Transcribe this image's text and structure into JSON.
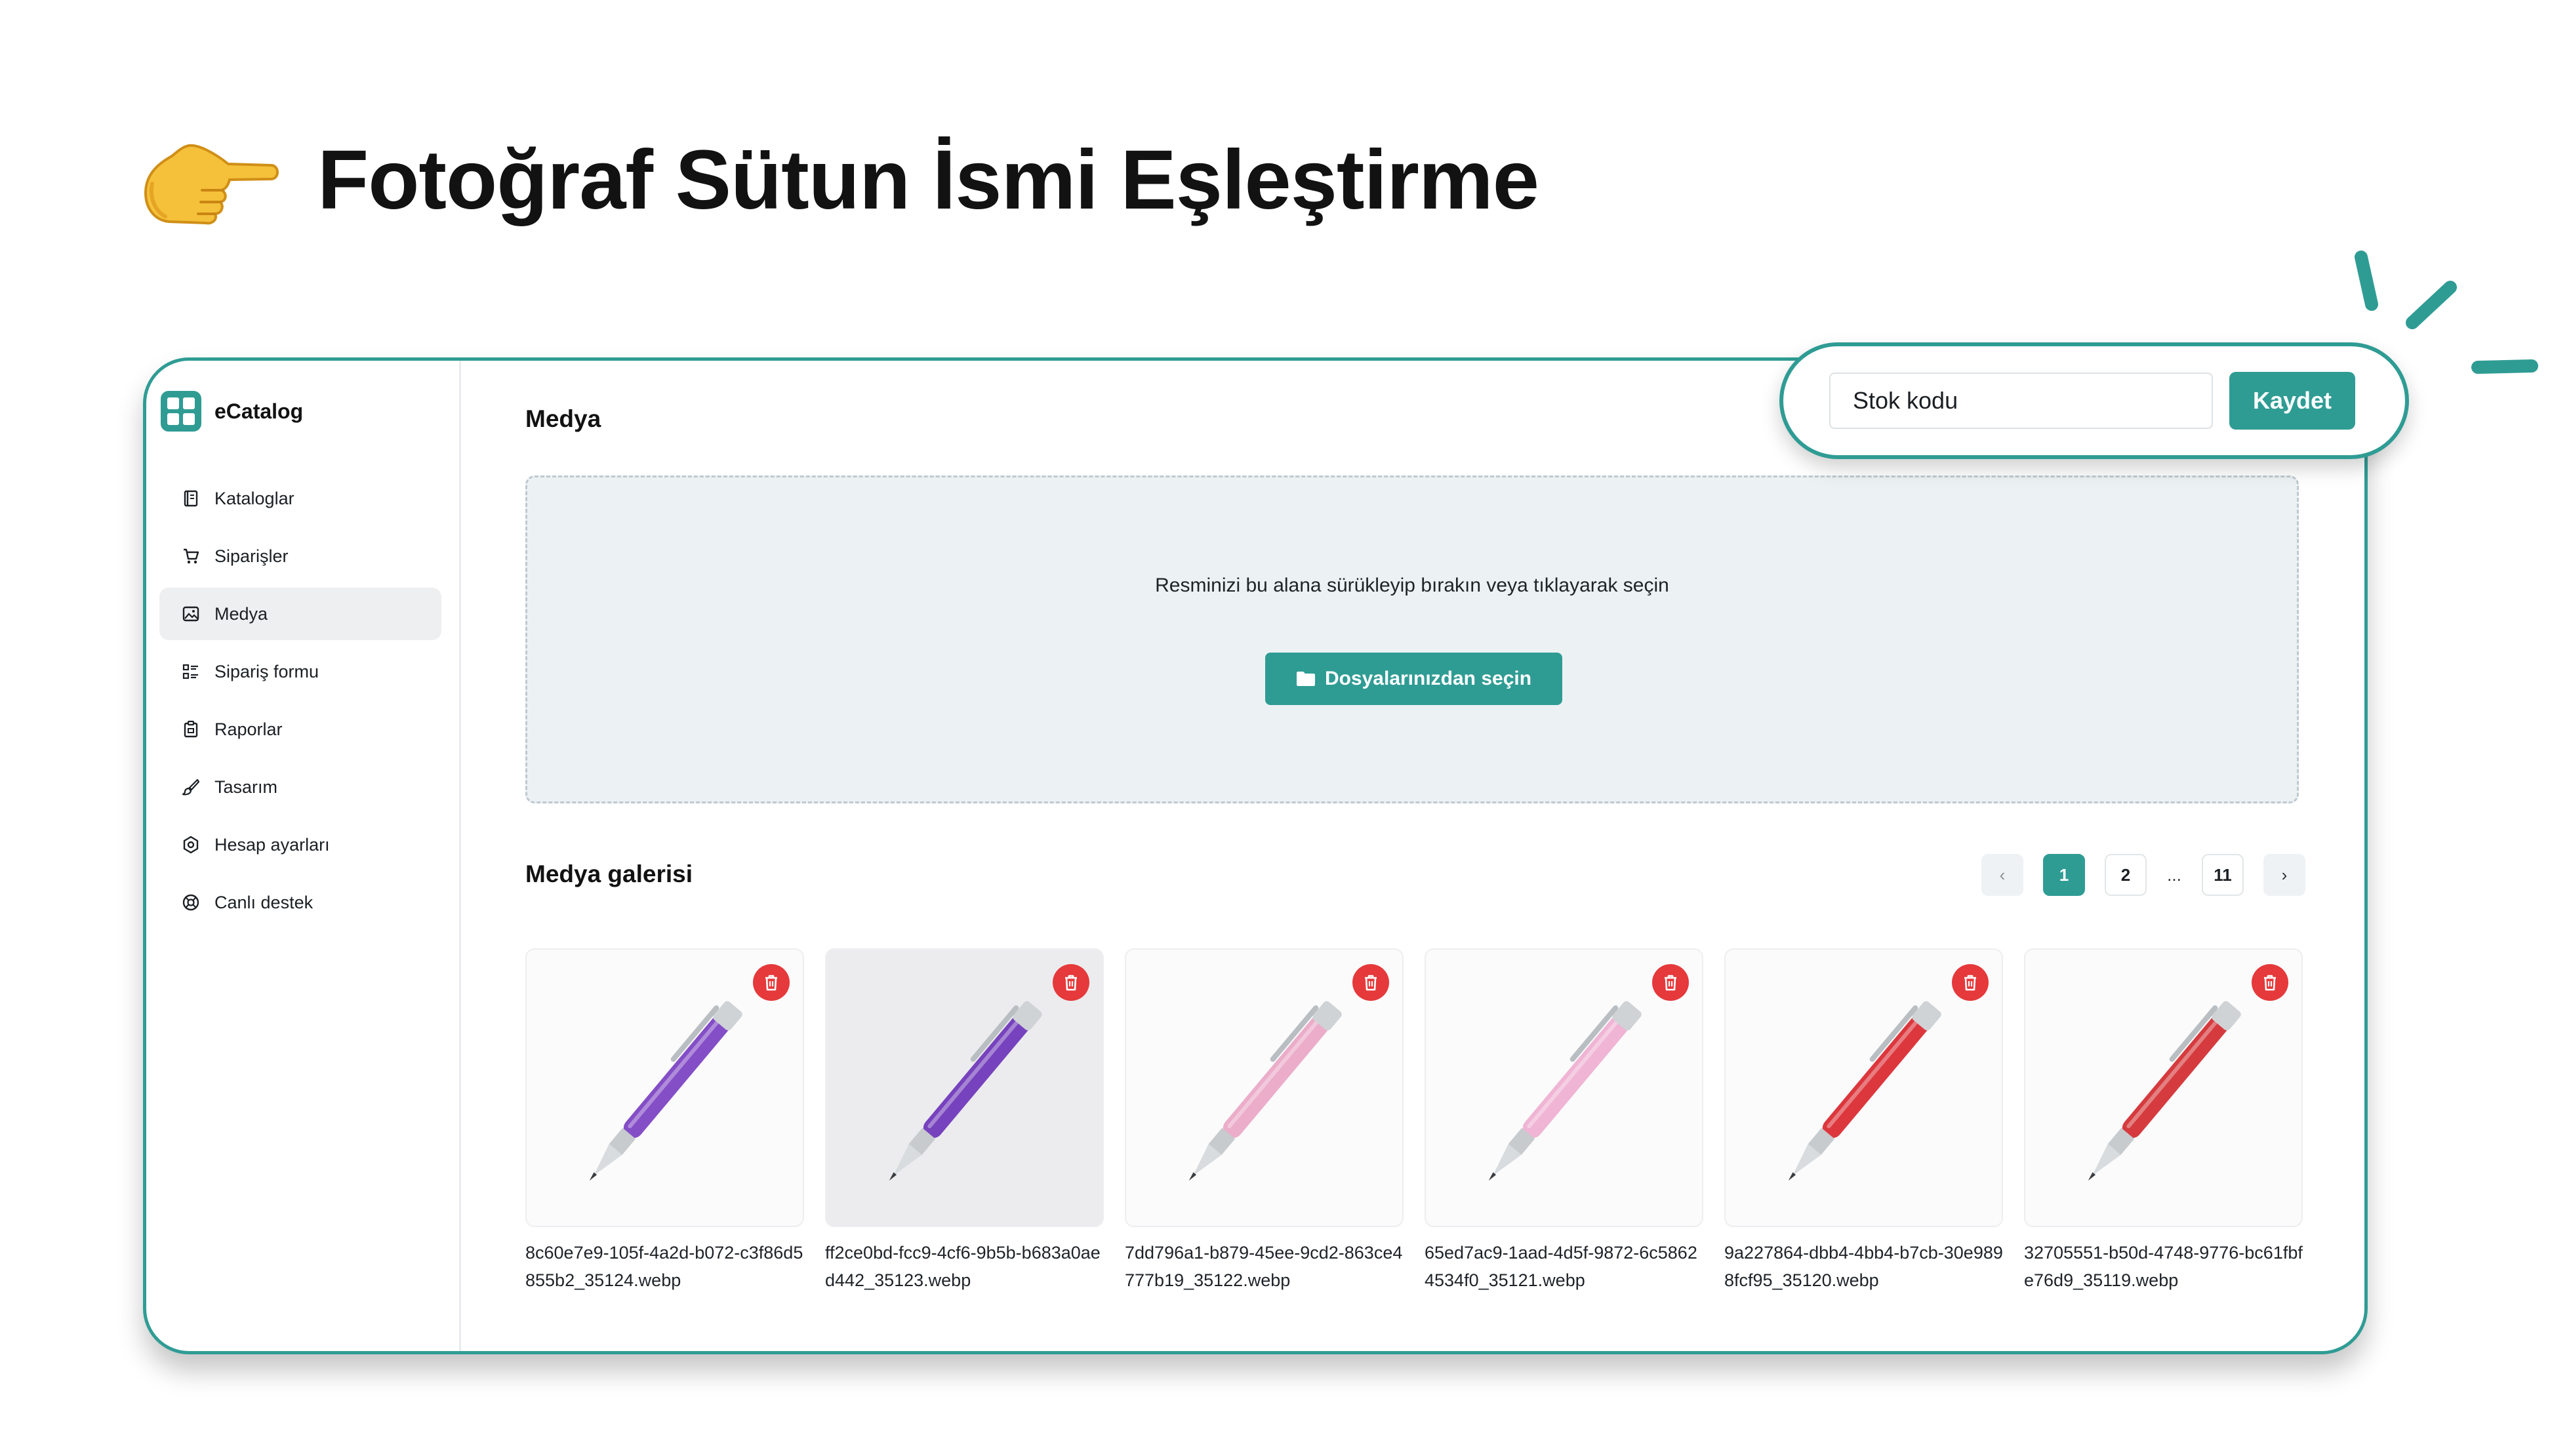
{
  "hero": {
    "title": "Fotoğraf Sütun İsmi Eşleştirme",
    "icon": "pointing-hand-icon"
  },
  "app": {
    "brand": "eCatalog",
    "accent_color": "#2f9c94",
    "sidebar": {
      "items": [
        {
          "label": "Kataloglar",
          "icon": "catalog-icon",
          "active": false
        },
        {
          "label": "Siparişler",
          "icon": "cart-icon",
          "active": false
        },
        {
          "label": "Medya",
          "icon": "image-icon",
          "active": true
        },
        {
          "label": "Sipariş formu",
          "icon": "form-icon",
          "active": false
        },
        {
          "label": "Raporlar",
          "icon": "clipboard-icon",
          "active": false
        },
        {
          "label": "Tasarım",
          "icon": "brush-icon",
          "active": false
        },
        {
          "label": "Hesap ayarları",
          "icon": "settings-icon",
          "active": false
        },
        {
          "label": "Canlı destek",
          "icon": "support-icon",
          "active": false
        }
      ]
    },
    "media": {
      "title": "Medya",
      "dropzone_text": "Resminizi bu alana sürükleyip bırakın veya tıklayarak seçin",
      "upload_button": "Dosyalarınızdan seçin"
    },
    "gallery": {
      "title": "Medya galerisi",
      "pagination": {
        "prev": "‹",
        "next": "›",
        "pages": [
          "1",
          "2",
          "...",
          "11"
        ],
        "current": "1"
      },
      "items": [
        {
          "filename": "8c60e7e9-105f-4a2d-b072-c3f86d5855b2_35124.webp",
          "pen_color": "#7a3fc2",
          "background": "#fbfbfc"
        },
        {
          "filename": "ff2ce0bd-fcc9-4cf6-9b5b-b683a0aed442_35123.webp",
          "pen_color": "#6d33b8",
          "background": "#ececee"
        },
        {
          "filename": "7dd796a1-b879-45ee-9cd2-863ce4777b19_35122.webp",
          "pen_color": "#e9a6c6",
          "background": "#fbfbfc"
        },
        {
          "filename": "65ed7ac9-1aad-4d5f-9872-6c58624534f0_35121.webp",
          "pen_color": "#efaed0",
          "background": "#fbfbfc"
        },
        {
          "filename": "9a227864-dbb4-4bb4-b7cb-30e9898fcf95_35120.webp",
          "pen_color": "#d9262c",
          "background": "#fbfbfc"
        },
        {
          "filename": "32705551-b50d-4748-9776-bc61fbfe76d9_35119.webp",
          "pen_color": "#d12a2e",
          "background": "#fbfbfc"
        }
      ]
    }
  },
  "callout": {
    "input_value": "Stok kodu",
    "save_button": "Kaydet"
  }
}
